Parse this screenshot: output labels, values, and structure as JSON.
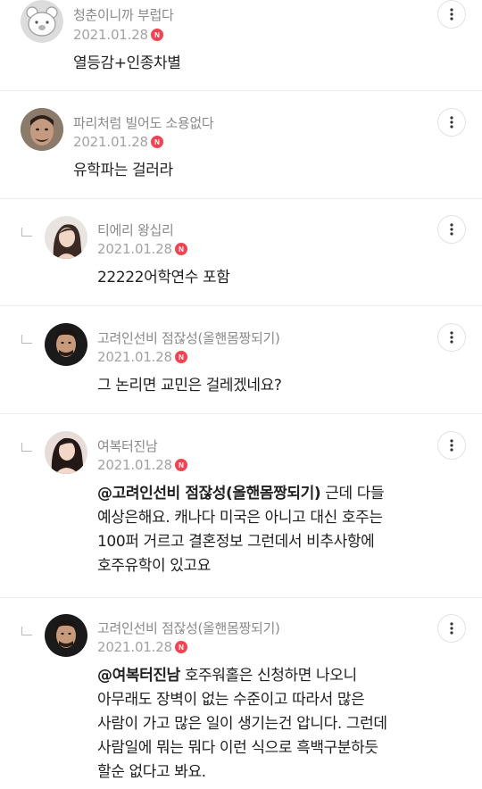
{
  "comments": [
    {
      "nickname": "청춘이니까 부럽다",
      "date": "2021.01.28",
      "badge": "N",
      "text": "열등감+인종차별",
      "avatar_icon": "bear-face-icon"
    },
    {
      "nickname": "파리처럼 빌어도 소용없다",
      "date": "2021.01.28",
      "badge": "N",
      "text": "유학파는 걸러라",
      "avatar_icon": "man-face-photo"
    },
    {
      "nickname": "티에리 왕십리",
      "date": "2021.01.28",
      "badge": "N",
      "text": "22222어학연수 포함",
      "avatar_icon": "woman-photo"
    },
    {
      "nickname": "고려인선비 점잖성(올핸몸짱되기)",
      "date": "2021.01.28",
      "badge": "N",
      "text": "그 논리면 교민은 걸레겠네요?",
      "avatar_icon": "singer-photo"
    },
    {
      "nickname": "여복터진남",
      "date": "2021.01.28",
      "badge": "N",
      "mention": "@고려인선비 점잖성(올핸몸짱되기)",
      "text_line1": " 근데 다들",
      "text_line2": "예상은해요. 캐나다 미국은 아니고 대신 호주는",
      "text_line3": "100퍼 거르고 결혼정보 그런데서 비추사항에",
      "text_line4": "호주유학이 있고요",
      "avatar_icon": "woman-photo"
    },
    {
      "nickname": "고려인선비 점잖성(올핸몸짱되기)",
      "date": "2021.01.28",
      "badge": "N",
      "mention": "@여복터진남",
      "text_line1": " 호주워홀은 신청하면 나오니",
      "text_line2": "아무래도 장벽이 없는 수준이고 따라서 많은",
      "text_line3": "사람이 가고 많은 일이 생기는건 압니다. 그런데",
      "text_line4": "사람일에 뭐는 뭐다 이런 식으로 흑백구분하듯",
      "text_line5": "할순 없다고 봐요.",
      "avatar_icon": "singer-photo"
    }
  ],
  "more_icon": "more-vertical-icon",
  "colors": {
    "badge": "#f04452",
    "nickname": "#8a8a8a",
    "date": "#a3a3a3",
    "divider": "#ececec"
  }
}
